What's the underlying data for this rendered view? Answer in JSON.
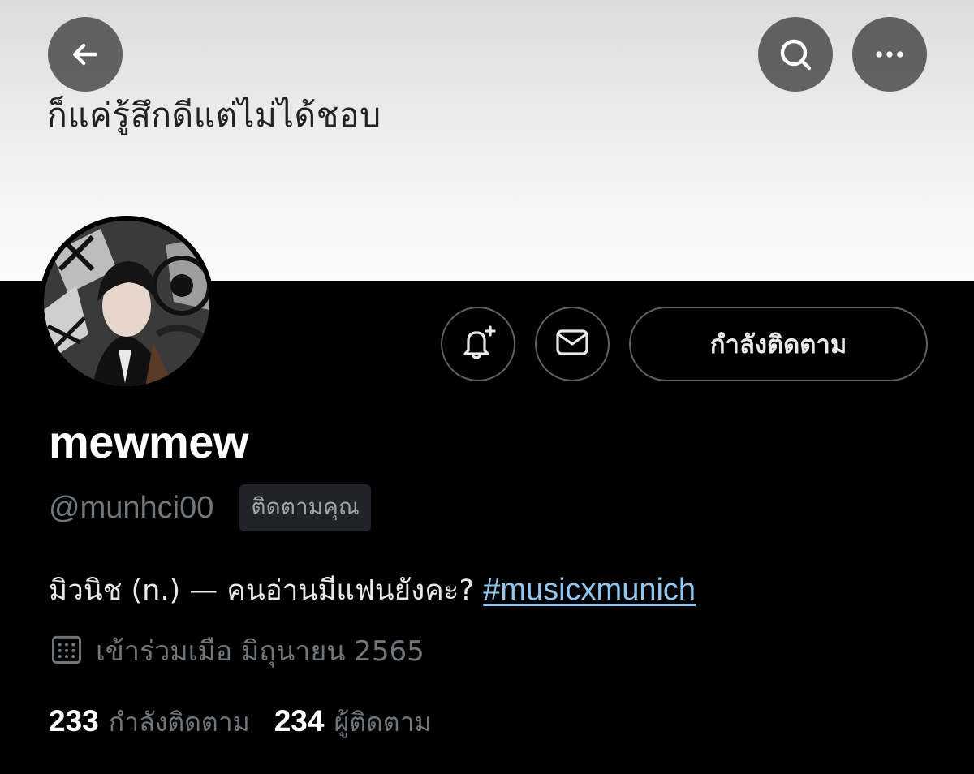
{
  "banner": {
    "text": "ก็แค่รู้สึกดีแต่ไม่ได้ชอบ"
  },
  "header": {
    "back_icon": "arrow-left-icon",
    "search_icon": "search-icon",
    "more_icon": "more-horizontal-icon"
  },
  "actions": {
    "notify_icon": "bell-plus-icon",
    "message_icon": "envelope-icon",
    "following_label": "กำลังติดตาม"
  },
  "profile": {
    "display_name": "mewmew",
    "handle": "@munhci00",
    "follows_you_badge": "ติดตามคุณ",
    "bio_text": "มิวนิช (n.) — คนอ่านมีแฟนยังคะ? ",
    "bio_hashtag": "#musicxmunich",
    "joined_icon": "calendar-icon",
    "joined_text": "เข้าร่วมเมือ มิถุนายน 2565"
  },
  "stats": {
    "following_count": "233",
    "following_label": "กำลังติดตาม",
    "followers_count": "234",
    "followers_label": "ผู้ติดตาม"
  },
  "colors": {
    "background": "#000000",
    "muted_text": "#71767b",
    "hashtag": "#8fc7f2",
    "button_border": "#5b6166"
  }
}
